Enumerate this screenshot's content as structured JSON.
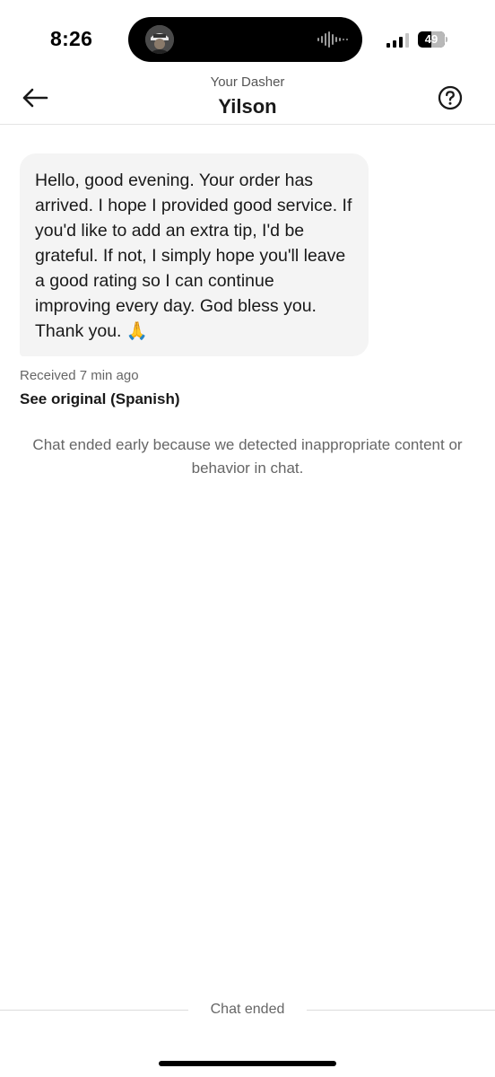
{
  "status_bar": {
    "time": "8:26",
    "battery_level": "49"
  },
  "header": {
    "subtitle": "Your Dasher",
    "title": "Yilson",
    "back_icon": "arrow-left-icon",
    "help_icon": "question-circle-icon"
  },
  "message": {
    "text": "Hello, good evening. Your order has arrived. I hope I provided good service. If you'd like to add an extra tip, I'd be grateful. If not, I simply hope you'll leave a good rating so I can continue improving every day. God bless you. Thank you. 🙏",
    "received": "Received 7 min ago",
    "see_original": "See original (Spanish)"
  },
  "notice": "Chat ended early because we detected inappropriate content or behavior in chat.",
  "footer": {
    "label": "Chat ended"
  }
}
